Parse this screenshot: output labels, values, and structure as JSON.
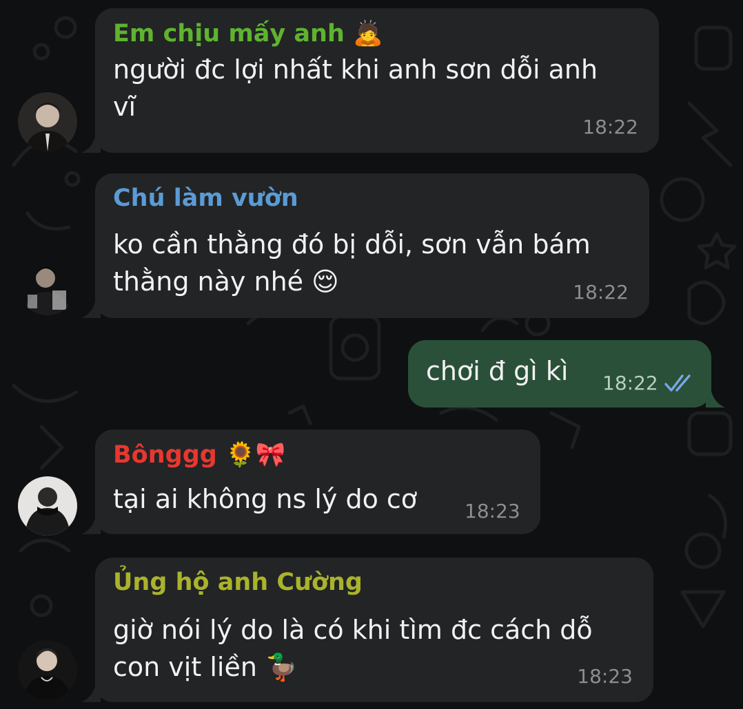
{
  "messages": [
    {
      "sender": "Em chịu mấy anh",
      "sender_emoji": "🙇",
      "sender_color": "#5fb32f",
      "lines": [
        "người đc lợi nhất khi anh sơn dỗi anh",
        "vĩ"
      ],
      "time": "18:22"
    },
    {
      "sender": "Chú làm vườn",
      "sender_color": "#5b9bd5",
      "lines": [
        "ko cần thằng đó bị dỗi, sơn vẫn bám",
        "thằng này nhé"
      ],
      "emoji": "😌",
      "time": "18:22"
    },
    {
      "outgoing": true,
      "lines": [
        "chơi đ gì kì"
      ],
      "time": "18:22",
      "status": "read-double-check-icon",
      "check_color": "#7aa7e8"
    },
    {
      "sender": "Bônggg",
      "sender_emoji": "🌻🎀",
      "sender_color": "#e8372f",
      "lines": [
        "tại ai không ns lý do cơ"
      ],
      "time": "18:23"
    },
    {
      "sender": "Ủng hộ anh Cường",
      "sender_color": "#aab32a",
      "lines": [
        "giờ nói lý do là có khi tìm đc cách dỗ",
        "con vịt liền"
      ],
      "emoji": "🦆",
      "time": "18:23"
    }
  ],
  "colors": {
    "incoming_bubble": "#222426",
    "outgoing_bubble": "#2b5039",
    "background": "#0f1011"
  }
}
